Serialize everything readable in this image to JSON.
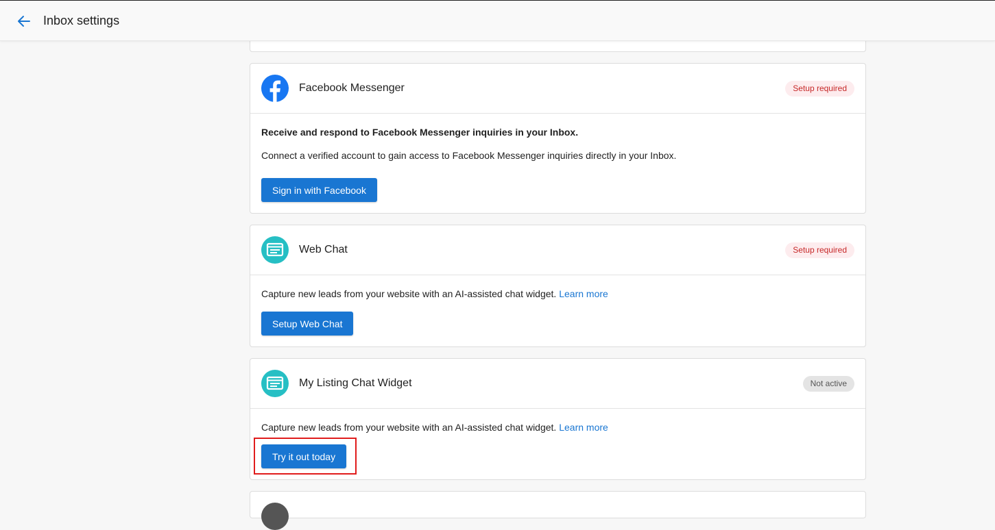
{
  "header": {
    "title": "Inbox settings"
  },
  "cards": {
    "facebook": {
      "title": "Facebook Messenger",
      "badge": "Setup required",
      "heading": "Receive and respond to Facebook Messenger inquiries in your Inbox.",
      "description": "Connect a verified account to gain access to Facebook Messenger inquiries directly in your Inbox.",
      "button": "Sign in with Facebook"
    },
    "webchat": {
      "title": "Web Chat",
      "badge": "Setup required",
      "description": "Capture new leads from your website with an AI-assisted chat widget.",
      "link": "Learn more",
      "button": "Setup Web Chat"
    },
    "listing": {
      "title": "My Listing Chat Widget",
      "badge": "Not active",
      "description": "Capture new leads from your website with an AI-assisted chat widget.",
      "link": "Learn more",
      "button": "Try it out today"
    }
  },
  "colors": {
    "primary": "#1976d2",
    "facebook": "#1877f2",
    "webchat": "#26bfc4",
    "setup_badge_bg": "#fdecee",
    "setup_badge_text": "#c62828",
    "inactive_badge_bg": "#e4e4e4",
    "highlight": "#e01b1b"
  },
  "icons": {
    "back": "arrow-left-icon",
    "facebook": "facebook-icon",
    "webchat": "chat-window-icon"
  }
}
